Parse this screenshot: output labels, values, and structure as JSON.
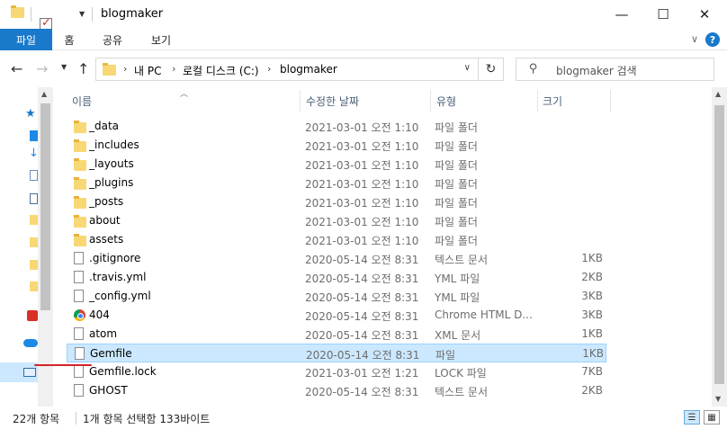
{
  "window": {
    "title": "blogmaker",
    "minimize": "—",
    "maximize": "☐",
    "close": "✕"
  },
  "ribbon": {
    "tabs": [
      "파일",
      "홈",
      "공유",
      "보기"
    ],
    "help": "?"
  },
  "address": {
    "crumbs": [
      "내 PC",
      "로컬 디스크 (C:)",
      "blogmaker"
    ],
    "search_placeholder": "blogmaker 검색"
  },
  "columns": {
    "name": "이름",
    "date": "수정한 날짜",
    "type": "유형",
    "size": "크기"
  },
  "files": [
    {
      "name": "_data",
      "date": "2021-03-01 오전 1:10",
      "type": "파일 폴더",
      "size": "",
      "icon": "folder"
    },
    {
      "name": "_includes",
      "date": "2021-03-01 오전 1:10",
      "type": "파일 폴더",
      "size": "",
      "icon": "folder"
    },
    {
      "name": "_layouts",
      "date": "2021-03-01 오전 1:10",
      "type": "파일 폴더",
      "size": "",
      "icon": "folder"
    },
    {
      "name": "_plugins",
      "date": "2021-03-01 오전 1:10",
      "type": "파일 폴더",
      "size": "",
      "icon": "folder"
    },
    {
      "name": "_posts",
      "date": "2021-03-01 오전 1:10",
      "type": "파일 폴더",
      "size": "",
      "icon": "folder"
    },
    {
      "name": "about",
      "date": "2021-03-01 오전 1:10",
      "type": "파일 폴더",
      "size": "",
      "icon": "folder"
    },
    {
      "name": "assets",
      "date": "2021-03-01 오전 1:10",
      "type": "파일 폴더",
      "size": "",
      "icon": "folder"
    },
    {
      "name": ".gitignore",
      "date": "2020-05-14 오전 8:31",
      "type": "텍스트 문서",
      "size": "1KB",
      "icon": "document"
    },
    {
      "name": ".travis.yml",
      "date": "2020-05-14 오전 8:31",
      "type": "YML 파일",
      "size": "2KB",
      "icon": "document"
    },
    {
      "name": "_config.yml",
      "date": "2020-05-14 오전 8:31",
      "type": "YML 파일",
      "size": "3KB",
      "icon": "document"
    },
    {
      "name": "404",
      "date": "2020-05-14 오전 8:31",
      "type": "Chrome HTML D...",
      "size": "3KB",
      "icon": "chrome"
    },
    {
      "name": "atom",
      "date": "2020-05-14 오전 8:31",
      "type": "XML 문서",
      "size": "1KB",
      "icon": "document"
    },
    {
      "name": "Gemfile",
      "date": "2020-05-14 오전 8:31",
      "type": "파일",
      "size": "1KB",
      "icon": "document",
      "selected": true
    },
    {
      "name": "Gemfile.lock",
      "date": "2021-03-01 오전 1:21",
      "type": "LOCK 파일",
      "size": "7KB",
      "icon": "document"
    },
    {
      "name": "GHOST",
      "date": "2020-05-14 오전 8:31",
      "type": "텍스트 문서",
      "size": "2KB",
      "icon": "document"
    }
  ],
  "status": {
    "count": "22개 항목",
    "selection": "1개 항목 선택함 133바이트"
  },
  "colors": {
    "file_tab": "#1979ca",
    "selection": "#cce8ff",
    "annotation_underline": "#d2232a"
  }
}
